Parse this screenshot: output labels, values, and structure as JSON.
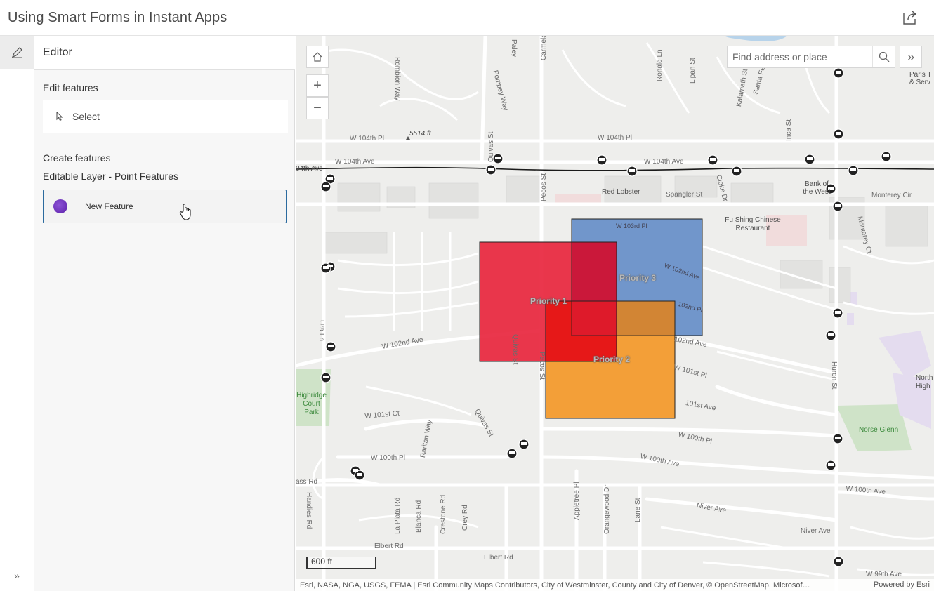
{
  "header": {
    "title": "Using Smart Forms in Instant Apps"
  },
  "panel": {
    "title": "Editor",
    "edit_label": "Edit features",
    "select_label": "Select",
    "create_label": "Create features",
    "layer_label": "Editable Layer - Point Features",
    "new_feature_label": "New Feature",
    "new_feature_color": "#6a2fb6"
  },
  "map": {
    "search_placeholder": "Find address or place",
    "scale_label": "600 ft",
    "attribution": "Esri, NASA, NGA, USGS, FEMA | Esri Community Maps Contributors, City of Westminster, County and City of Denver, © OpenStreetMap, Microsof…",
    "powered_by": "Powered by Esri",
    "polygons": [
      {
        "label": "Priority 1",
        "color": "#e8213a"
      },
      {
        "label": "Priority 2",
        "color": "#f29a2e"
      },
      {
        "label": "Priority 3",
        "color": "#5b86c5"
      }
    ],
    "labels": {
      "rombion": "Rombion Way",
      "pompey": "Pompey Way",
      "paley": "Paley",
      "carmela": "Carmela Ln",
      "ronald": "Ronald Ln",
      "lipan": "Lipan St",
      "kalamath": "Kalamath St",
      "santafe": "Santa Fe St",
      "inca": "Inca St",
      "quivas_n": "Quivas St",
      "w104pl_a": "W 104th Pl",
      "w104pl_b": "W 104th Pl",
      "w104ave_a": "W 104th Ave",
      "w104ave_b": "W 104th Ave",
      "w104ave_edge": "04th Ave",
      "elev": "5514 ft",
      "pecos_n": "Pecos St",
      "redlobster": "Red Lobster",
      "spangler": "Spangler St",
      "cloke": "Cloke Dr",
      "bank": "Bank of the West",
      "monterey_cir": "Monterey Cir",
      "monterey_ct": "Monterey Ct",
      "paris": "Paris T & Serv",
      "fushing": "Fu Shing Chinese Restaurant",
      "w103pl": "W 103rd Pl",
      "w102ave_e": "W 102nd Ave",
      "w102pl": "102nd Pl",
      "w102nd_ave_e": "102nd Ave",
      "w101pl": "W 101st Pl",
      "w101ave": "101st Ave",
      "w102ave": "W 102nd Ave",
      "quivas": "Quivas St",
      "pecos": "Pecos St",
      "ura": "Ura Ln",
      "highridge": "Highridge Court Park",
      "w101ct": "W 101st Ct",
      "raritan": "Raritan Way",
      "quivas_s": "Quivas St",
      "w100pl": "W 100th Pl",
      "w100pl_e": "W 100th Pl",
      "w100ave": "W 100th Ave",
      "w100ave_e": "W 100th Ave",
      "huron": "Huron St",
      "norse": "Norse Glenn",
      "north_high": "North High",
      "ass": "ass Rd",
      "handies": "Handies Rd",
      "laplata": "La Plata Rd",
      "blanca": "Blanca Rd",
      "crestone": "Crestone Rd",
      "crey": "Crey Rd",
      "appletree": "Appletree Pl",
      "orangewood": "Orangewood Dr",
      "lane": "Lane St",
      "niver": "Niver Ave",
      "niver_e": "Niver Ave",
      "elbert": "Elbert Rd",
      "elbert2": "Elbert Rd",
      "w99ave": "W 99th Ave"
    }
  }
}
